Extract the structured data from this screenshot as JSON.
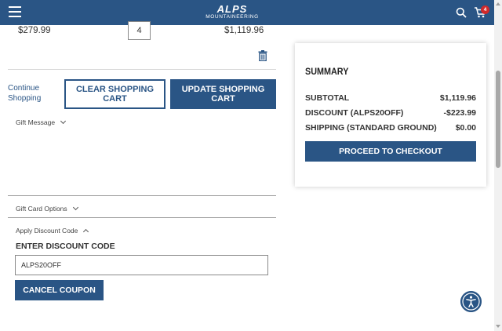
{
  "header": {
    "logo_main": "ALPS",
    "logo_sub": "MOUNTAINEERING",
    "cart_count": "4",
    "menu_icon": "hamburger-icon",
    "search_icon": "search-icon",
    "cart_icon": "cart-icon"
  },
  "cart_item": {
    "price": "$279.99",
    "quantity": "4",
    "subtotal": "$1,119.96"
  },
  "actions": {
    "continue_shopping": "Continue Shopping",
    "clear_cart": "CLEAR SHOPPING CART",
    "update_cart": "UPDATE SHOPPING CART"
  },
  "sections": {
    "gift_message": "Gift Message",
    "gift_card_options": "Gift Card Options",
    "apply_discount": "Apply Discount Code"
  },
  "discount": {
    "label": "ENTER DISCOUNT CODE",
    "code": "ALPS20OFF",
    "cancel_label": "CANCEL COUPON"
  },
  "summary": {
    "title": "SUMMARY",
    "rows": [
      {
        "label": "SUBTOTAL",
        "value": "$1,119.96"
      },
      {
        "label": "DISCOUNT (ALPS20OFF)",
        "value": "-$223.99"
      },
      {
        "label": "SHIPPING (STANDARD GROUND)",
        "value": "$0.00"
      }
    ],
    "checkout_label": "PROCEED TO CHECKOUT"
  },
  "colors": {
    "brand": "#2a5585",
    "badge": "#d22a2a"
  }
}
